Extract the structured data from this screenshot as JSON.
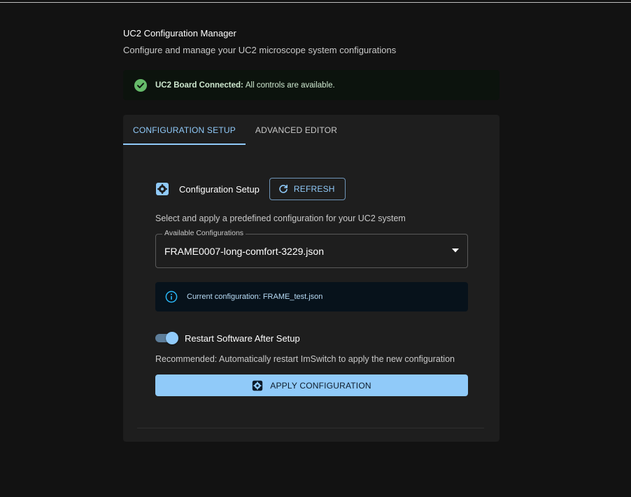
{
  "header": {
    "title": "UC2 Configuration Manager",
    "subtitle": "Configure and manage your UC2 microscope system configurations"
  },
  "status": {
    "label": "UC2 Board Connected:",
    "message": "All controls are available.",
    "icon": "check-circle-icon",
    "color": "#66bb6a"
  },
  "tabs": [
    {
      "label": "CONFIGURATION SETUP",
      "active": true
    },
    {
      "label": "ADVANCED EDITOR",
      "active": false
    }
  ],
  "setup": {
    "title": "Configuration Setup",
    "icon": "settings-gear-icon",
    "refresh_label": "REFRESH",
    "description": "Select and apply a predefined configuration for your UC2 system"
  },
  "select": {
    "label": "Available Configurations",
    "value": "FRAME0007-long-comfort-3229.json"
  },
  "info": {
    "text": "Current configuration: FRAME_test.json",
    "icon": "info-icon"
  },
  "restart": {
    "label": "Restart Software After Setup",
    "checked": true,
    "hint": "Recommended: Automatically restart ImSwitch to apply the new configuration"
  },
  "apply": {
    "label": "APPLY CONFIGURATION"
  },
  "colors": {
    "accent": "#90caf9",
    "background": "#121212",
    "card": "#1e1e1e"
  }
}
